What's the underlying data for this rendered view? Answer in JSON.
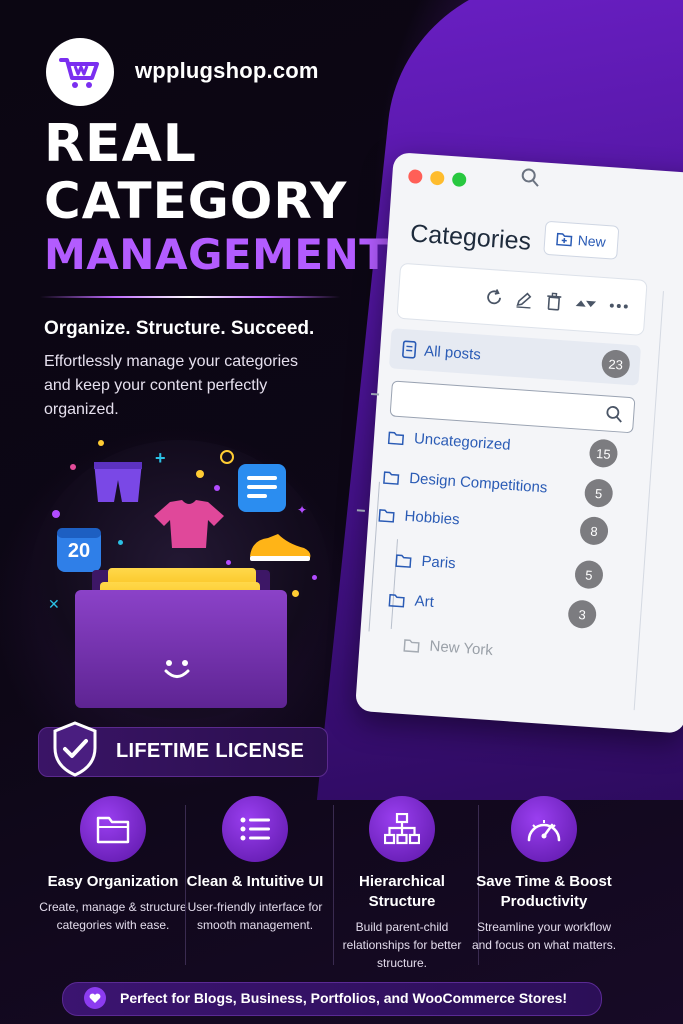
{
  "brand": {
    "site": "wpplugshop.com"
  },
  "hero": {
    "title_line1": "REAL",
    "title_line2": "CATEGORY",
    "title_line3": "MANAGEMENT",
    "tagline": "Organize. Structure. Succeed.",
    "description": "Effortlessly manage your categories and keep your content perfectly organized."
  },
  "illustration": {
    "calendar_number": "20"
  },
  "license": {
    "label": "LIFETIME LICENSE"
  },
  "window": {
    "title": "Categories",
    "new_button": "New",
    "all_posts": {
      "label": "All posts",
      "count": "23"
    },
    "search_placeholder": "",
    "categories": [
      {
        "label": "Uncategorized",
        "count": "15"
      },
      {
        "label": "Design Competitions",
        "count": "5"
      },
      {
        "label": "Hobbies",
        "count": "8"
      },
      {
        "label": "Paris",
        "count": "5"
      },
      {
        "label": "Art",
        "count": "3"
      },
      {
        "label": "New York",
        "count": ""
      }
    ]
  },
  "features": [
    {
      "title": "Easy Organization",
      "desc": "Create, manage & structure categories with ease.",
      "icon": "folder-icon"
    },
    {
      "title": "Clean & Intuitive UI",
      "desc": "User-friendly interface for smooth management.",
      "icon": "list-icon"
    },
    {
      "title": "Hierarchical Structure",
      "desc": "Build parent-child relationships for better structure.",
      "icon": "hierarchy-icon"
    },
    {
      "title": "Save Time & Boost Productivity",
      "desc": "Streamline your workflow and focus on what matters.",
      "icon": "speedometer-icon"
    }
  ],
  "banner": {
    "text": "Perfect for Blogs, Business, Portfolios, and WooCommerce Stores!"
  },
  "colors": {
    "accent": "#b35cff",
    "brand_purple": "#6a1fc4",
    "link_blue": "#2a5bb5",
    "folder_yellow": "#ffc81a"
  }
}
